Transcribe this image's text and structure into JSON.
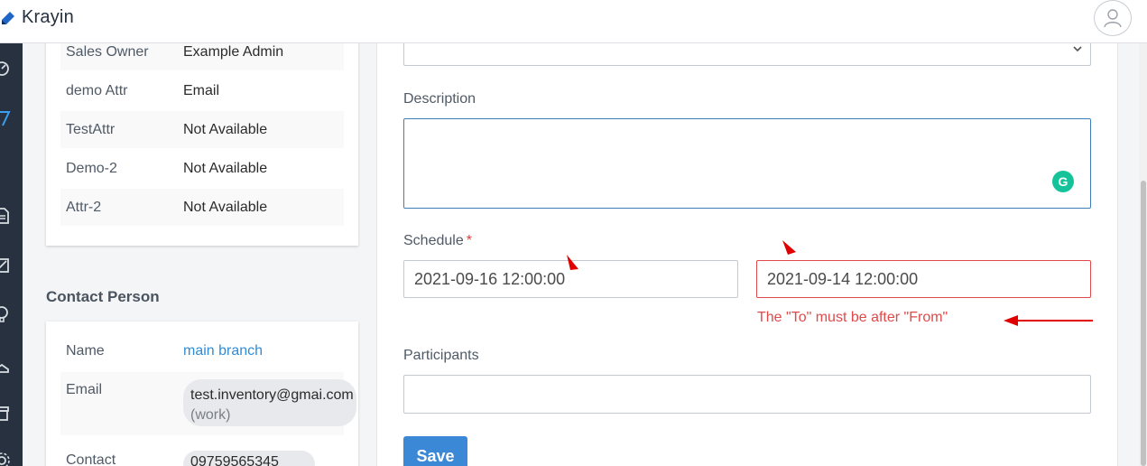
{
  "app": {
    "brand": "Krayin"
  },
  "header": {
    "avatar_icon": "user-avatar-icon"
  },
  "lead_info": [
    {
      "key": "Sales Owner",
      "value": "Example Admin"
    },
    {
      "key": "demo Attr",
      "value": "Email"
    },
    {
      "key": "TestAttr",
      "value": "Not Available"
    },
    {
      "key": "Demo-2",
      "value": "Not Available"
    },
    {
      "key": "Attr-2",
      "value": "Not Available"
    }
  ],
  "contact": {
    "title": "Contact Person",
    "name_label": "Name",
    "name_value": "main branch",
    "email_label": "Email",
    "email_value": "test.inventory@gmai.com",
    "email_type": "(work)",
    "contact_label": "Contact",
    "contact_value": "09759565345"
  },
  "form": {
    "description_label": "Description",
    "description_value": "",
    "schedule_label": "Schedule",
    "required_mark": "*",
    "from_value": "2021-09-16 12:00:00",
    "to_value": "2021-09-14 12:00:00",
    "error_text": "The \"To\" must be after \"From\"",
    "participants_label": "Participants",
    "participants_value": "",
    "save_label": "Save"
  },
  "colors": {
    "accent": "#3a88d6",
    "error": "#e04a4a",
    "sidebar": "#27313f",
    "annotation": "#e00000"
  }
}
